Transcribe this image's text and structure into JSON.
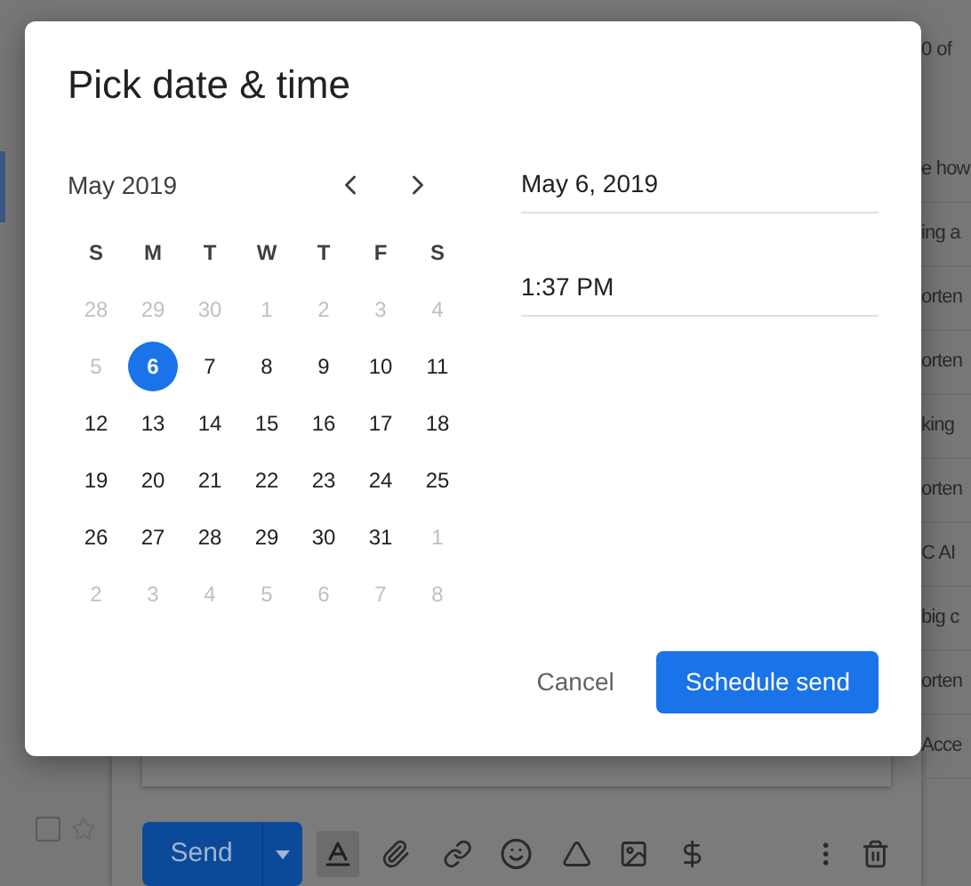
{
  "background": {
    "pagination": "0 of",
    "row_checkbox": {
      "checked": false
    },
    "message_snippets": [
      "e how",
      "ing a",
      "orten",
      "orten",
      "king",
      "orten",
      "C AI",
      "big c",
      "orten",
      "Acce"
    ]
  },
  "compose": {
    "send_button": "Send"
  },
  "dialog": {
    "title": "Pick date & time",
    "calendar": {
      "month": "May 2019",
      "weekdays": [
        "S",
        "M",
        "T",
        "W",
        "T",
        "F",
        "S"
      ],
      "weeks": [
        [
          {
            "day": "28",
            "muted": true,
            "selected": false
          },
          {
            "day": "29",
            "muted": true,
            "selected": false
          },
          {
            "day": "30",
            "muted": true,
            "selected": false
          },
          {
            "day": "1",
            "muted": true,
            "selected": false
          },
          {
            "day": "2",
            "muted": true,
            "selected": false
          },
          {
            "day": "3",
            "muted": true,
            "selected": false
          },
          {
            "day": "4",
            "muted": true,
            "selected": false
          }
        ],
        [
          {
            "day": "5",
            "muted": true,
            "selected": false
          },
          {
            "day": "6",
            "muted": false,
            "selected": true
          },
          {
            "day": "7",
            "muted": false,
            "selected": false
          },
          {
            "day": "8",
            "muted": false,
            "selected": false
          },
          {
            "day": "9",
            "muted": false,
            "selected": false
          },
          {
            "day": "10",
            "muted": false,
            "selected": false
          },
          {
            "day": "11",
            "muted": false,
            "selected": false
          }
        ],
        [
          {
            "day": "12",
            "muted": false,
            "selected": false
          },
          {
            "day": "13",
            "muted": false,
            "selected": false
          },
          {
            "day": "14",
            "muted": false,
            "selected": false
          },
          {
            "day": "15",
            "muted": false,
            "selected": false
          },
          {
            "day": "16",
            "muted": false,
            "selected": false
          },
          {
            "day": "17",
            "muted": false,
            "selected": false
          },
          {
            "day": "18",
            "muted": false,
            "selected": false
          }
        ],
        [
          {
            "day": "19",
            "muted": false,
            "selected": false
          },
          {
            "day": "20",
            "muted": false,
            "selected": false
          },
          {
            "day": "21",
            "muted": false,
            "selected": false
          },
          {
            "day": "22",
            "muted": false,
            "selected": false
          },
          {
            "day": "23",
            "muted": false,
            "selected": false
          },
          {
            "day": "24",
            "muted": false,
            "selected": false
          },
          {
            "day": "25",
            "muted": false,
            "selected": false
          }
        ],
        [
          {
            "day": "26",
            "muted": false,
            "selected": false
          },
          {
            "day": "27",
            "muted": false,
            "selected": false
          },
          {
            "day": "28",
            "muted": false,
            "selected": false
          },
          {
            "day": "29",
            "muted": false,
            "selected": false
          },
          {
            "day": "30",
            "muted": false,
            "selected": false
          },
          {
            "day": "31",
            "muted": false,
            "selected": false
          },
          {
            "day": "1",
            "muted": true,
            "selected": false
          }
        ],
        [
          {
            "day": "2",
            "muted": true,
            "selected": false
          },
          {
            "day": "3",
            "muted": true,
            "selected": false
          },
          {
            "day": "4",
            "muted": true,
            "selected": false
          },
          {
            "day": "5",
            "muted": true,
            "selected": false
          },
          {
            "day": "6",
            "muted": true,
            "selected": false
          },
          {
            "day": "7",
            "muted": true,
            "selected": false
          },
          {
            "day": "8",
            "muted": true,
            "selected": false
          }
        ]
      ]
    },
    "date_field": {
      "value": "May 6, 2019"
    },
    "time_field": {
      "value": "1:37 PM"
    },
    "buttons": [
      {
        "label": "Cancel",
        "kind": "text"
      },
      {
        "label": "Schedule send",
        "kind": "primary"
      }
    ]
  }
}
